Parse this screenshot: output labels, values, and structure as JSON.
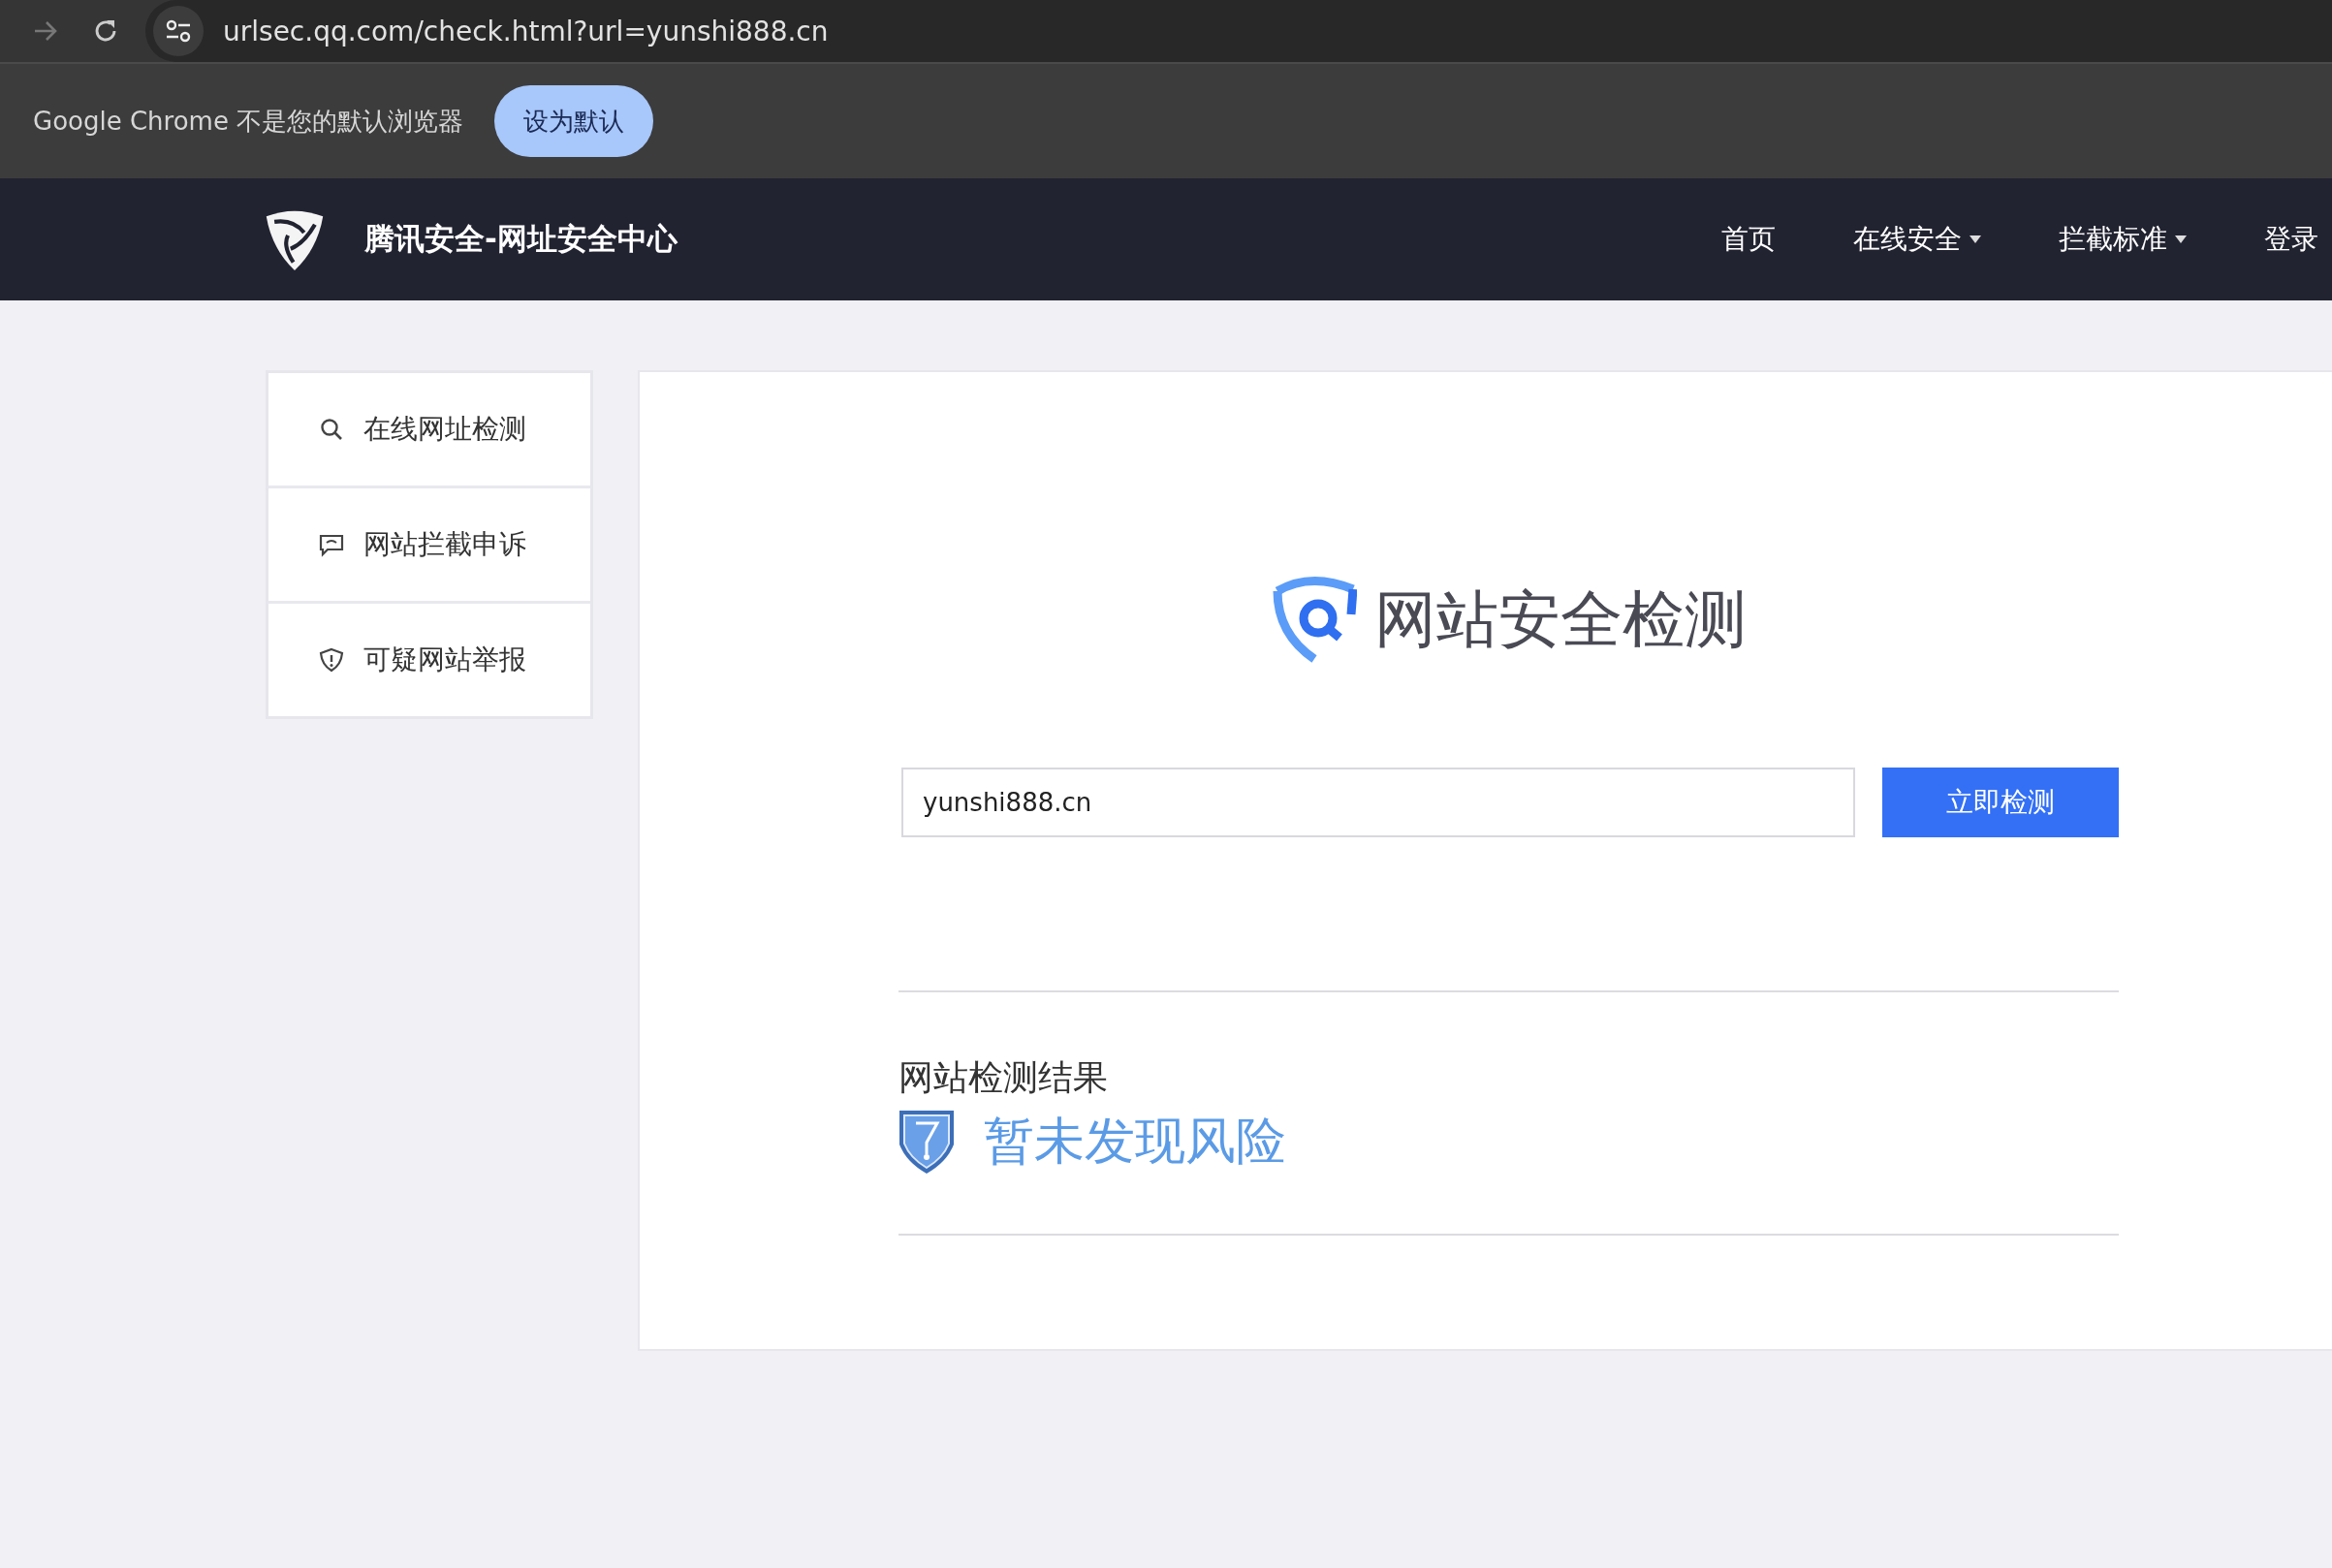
{
  "browser": {
    "url": "urlsec.qq.com/check.html?url=yunshi888.cn"
  },
  "infobar": {
    "message": "Google Chrome 不是您的默认浏览器",
    "button": "设为默认"
  },
  "header": {
    "site_title": "腾讯安全-网址安全中心",
    "nav": [
      {
        "label": "首页",
        "has_menu": false
      },
      {
        "label": "在线安全",
        "has_menu": true
      },
      {
        "label": "拦截标准",
        "has_menu": true
      },
      {
        "label": "登录",
        "has_menu": false
      }
    ]
  },
  "sidebar": {
    "items": [
      {
        "label": "在线网址检测",
        "kind": "search"
      },
      {
        "label": "网站拦截申诉",
        "kind": "appeal"
      },
      {
        "label": "可疑网站举报",
        "kind": "report"
      }
    ]
  },
  "main": {
    "title": "网站安全检测",
    "url_input": {
      "value": "yunshi888.cn"
    },
    "check_button": "立即检测",
    "result": {
      "heading": "网站检测结果",
      "status": "暂未发现风险"
    }
  }
}
